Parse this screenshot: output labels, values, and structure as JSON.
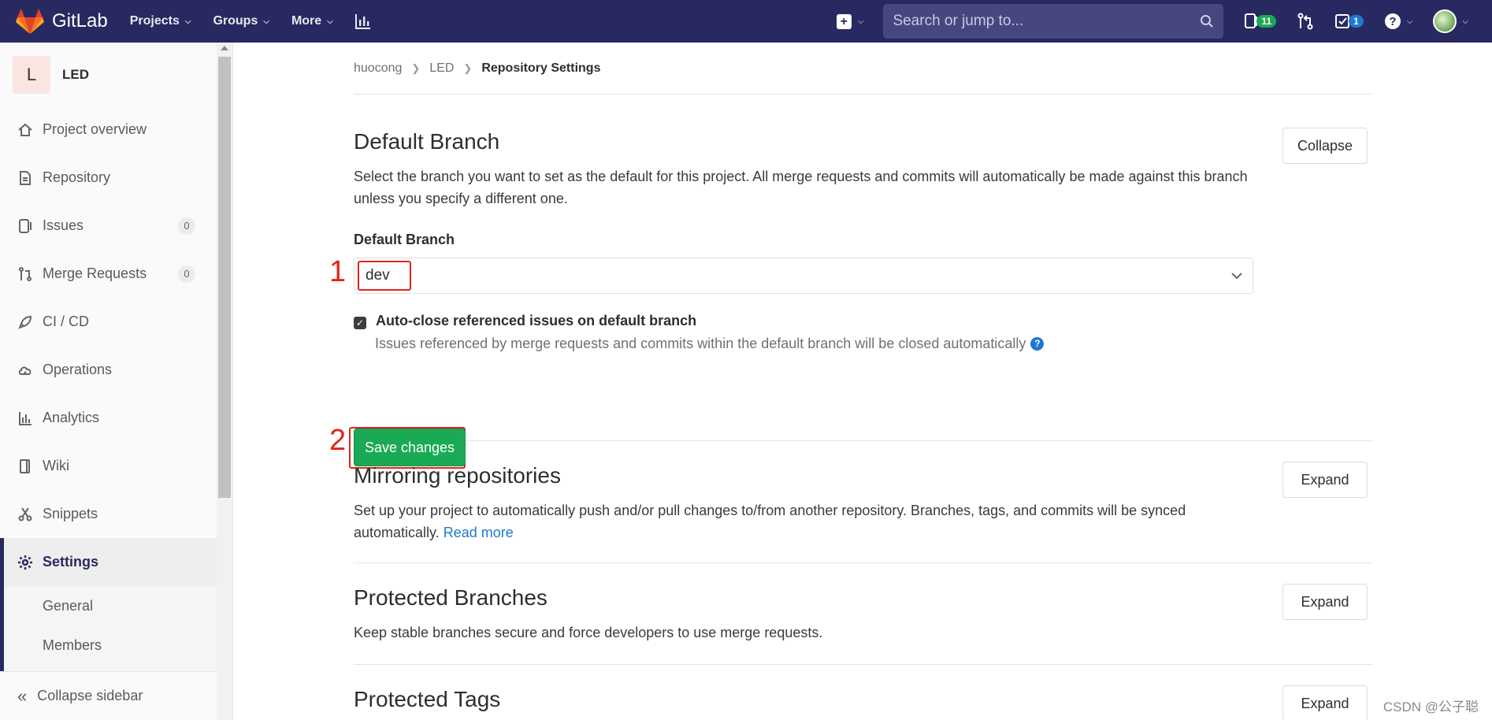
{
  "navbar": {
    "brand": "GitLab",
    "items": [
      {
        "label": "Projects"
      },
      {
        "label": "Groups"
      },
      {
        "label": "More"
      }
    ],
    "search_placeholder": "Search or jump to...",
    "issues_badge": "11",
    "todos_badge": "1"
  },
  "sidebar": {
    "project_initial": "L",
    "project_name": "LED",
    "items": [
      {
        "label": "Project overview",
        "icon": "home-icon"
      },
      {
        "label": "Repository",
        "icon": "document-icon"
      },
      {
        "label": "Issues",
        "icon": "issues-icon",
        "count": "0"
      },
      {
        "label": "Merge Requests",
        "icon": "merge-request-icon",
        "count": "0"
      },
      {
        "label": "CI / CD",
        "icon": "rocket-icon"
      },
      {
        "label": "Operations",
        "icon": "cloud-gear-icon"
      },
      {
        "label": "Analytics",
        "icon": "chart-icon"
      },
      {
        "label": "Wiki",
        "icon": "book-icon"
      },
      {
        "label": "Snippets",
        "icon": "scissors-icon"
      }
    ],
    "active": {
      "label": "Settings",
      "icon": "gear-icon"
    },
    "subitems": [
      {
        "label": "General"
      },
      {
        "label": "Members"
      }
    ],
    "collapse_label": "Collapse sidebar"
  },
  "breadcrumb": {
    "items": [
      "huocong",
      "LED"
    ],
    "current": "Repository Settings"
  },
  "sections": {
    "default_branch": {
      "title": "Default Branch",
      "description": "Select the branch you want to set as the default for this project. All merge requests and commits will automatically be made against this branch unless you specify a different one.",
      "toggle": "Collapse",
      "field_label": "Default Branch",
      "selected_branch": "dev",
      "checkbox_label": "Auto-close referenced issues on default branch",
      "checkbox_checked": true,
      "checkbox_help": "Issues referenced by merge requests and commits within the default branch will be closed automatically",
      "save_label": "Save changes"
    },
    "mirroring": {
      "title": "Mirroring repositories",
      "description": "Set up your project to automatically push and/or pull changes to/from another repository. Branches, tags, and commits will be synced automatically.",
      "link": "Read more",
      "toggle": "Expand"
    },
    "protected_branches": {
      "title": "Protected Branches",
      "description": "Keep stable branches secure and force developers to use merge requests.",
      "toggle": "Expand"
    },
    "protected_tags": {
      "title": "Protected Tags",
      "toggle": "Expand"
    }
  },
  "annotations": {
    "step1": "1",
    "step2": "2"
  },
  "watermark": "CSDN @公子聪",
  "colors": {
    "navbar": "#292961",
    "save_button": "#1aaa55",
    "annotation": "#e0251b",
    "link": "#1f78d1"
  }
}
